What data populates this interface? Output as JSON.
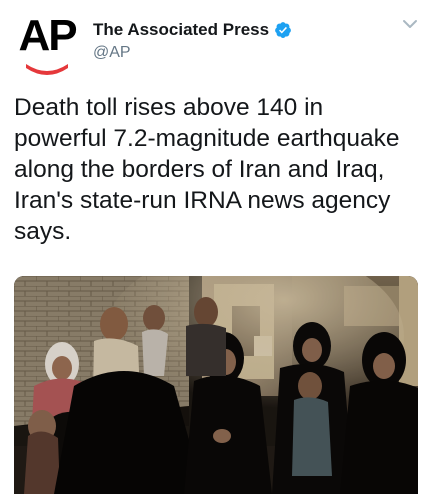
{
  "author": {
    "avatar_text": "AP",
    "display_name": "The Associated Press",
    "handle": "@AP",
    "verified": true
  },
  "icons": {
    "verified": "verified-badge-icon",
    "menu": "chevron-down-icon"
  },
  "colors": {
    "verified_blue": "#1da1f2",
    "ap_red": "#e5383b",
    "handle_gray": "#657786",
    "text": "#14171a"
  },
  "tweet": {
    "text": "Death toll rises above 140 in powerful 7.2-magnitude earthquake along the borders of Iran and Iraq, Iran's state-run IRNA news agency says."
  }
}
